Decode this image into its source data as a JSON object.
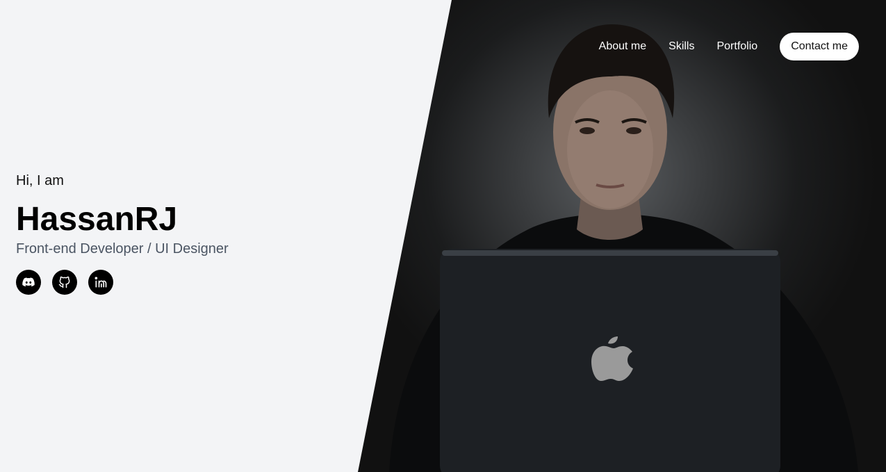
{
  "nav": {
    "links": [
      "About me",
      "Skills",
      "Portfolio"
    ],
    "cta_label": "Contact me"
  },
  "intro": {
    "greeting": "Hi, I am",
    "name": "HassanRJ",
    "role": "Front-end Developer / UI Designer"
  },
  "socials": [
    {
      "icon": "discord-icon"
    },
    {
      "icon": "github-icon"
    },
    {
      "icon": "linkedin-icon"
    }
  ],
  "colors": {
    "background": "#f3f4f6",
    "text": "#000000",
    "muted": "#4b5563",
    "nav_text": "#ffffff"
  }
}
